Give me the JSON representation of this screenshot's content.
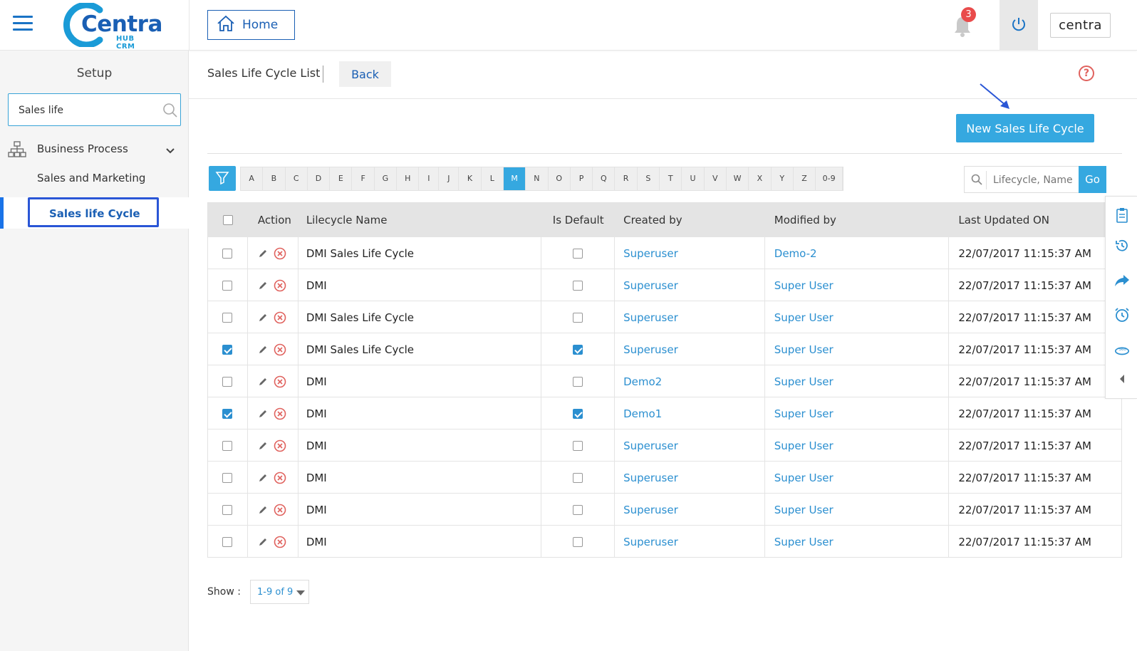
{
  "header": {
    "logo_text": "Centra",
    "logo_sub": "HUB CRM",
    "home_label": "Home",
    "notification_count": "3",
    "brand_label": "centra"
  },
  "sidebar": {
    "title": "Setup",
    "search_value": "Sales life",
    "group_label": "Business Process",
    "items": [
      {
        "label": "Sales and Marketing"
      },
      {
        "label": "Sales life Cycle"
      }
    ]
  },
  "toolbar": {
    "title": "Sales Life Cycle  List",
    "back_label": "Back",
    "help_glyph": "?",
    "new_button_label": "New  Sales Life Cycle"
  },
  "alphabet": [
    "A",
    "B",
    "C",
    "D",
    "E",
    "F",
    "G",
    "H",
    "I",
    "J",
    "K",
    "L",
    "M",
    "N",
    "O",
    "P",
    "Q",
    "R",
    "S",
    "T",
    "U",
    "V",
    "W",
    "X",
    "Y",
    "Z",
    "0-9"
  ],
  "alphabet_active": "M",
  "search": {
    "placeholder": "Lifecycle, Name",
    "go_label": "Go"
  },
  "table": {
    "columns": [
      "Action",
      "Lilecycle Name",
      "Is Default",
      "Created by",
      "Modified by",
      "Last Updated ON"
    ],
    "rows": [
      {
        "selected": false,
        "name": "DMI Sales Life Cycle",
        "is_default": false,
        "created_by": "Superuser",
        "modified_by": "Demo-2",
        "updated": "22/07/2017 11:15:37 AM"
      },
      {
        "selected": false,
        "name": "DMI",
        "is_default": false,
        "created_by": "Superuser",
        "modified_by": "Super User",
        "updated": "22/07/2017 11:15:37 AM"
      },
      {
        "selected": false,
        "name": "DMI Sales Life Cycle",
        "is_default": false,
        "created_by": "Superuser",
        "modified_by": "Super User",
        "updated": "22/07/2017 11:15:37 AM"
      },
      {
        "selected": true,
        "name": "DMI Sales Life Cycle",
        "is_default": true,
        "created_by": "Superuser",
        "modified_by": "Super User",
        "updated": "22/07/2017 11:15:37 AM"
      },
      {
        "selected": false,
        "name": "DMI",
        "is_default": false,
        "created_by": "Demo2",
        "modified_by": "Super User",
        "updated": "22/07/2017 11:15:37 AM"
      },
      {
        "selected": true,
        "name": "DMI",
        "is_default": true,
        "created_by": "Demo1",
        "modified_by": "Super User",
        "updated": "22/07/2017 11:15:37 AM"
      },
      {
        "selected": false,
        "name": "DMI",
        "is_default": false,
        "created_by": "Superuser",
        "modified_by": "Super User",
        "updated": "22/07/2017 11:15:37 AM"
      },
      {
        "selected": false,
        "name": "DMI",
        "is_default": false,
        "created_by": "Superuser",
        "modified_by": "Super User",
        "updated": "22/07/2017 11:15:37 AM"
      },
      {
        "selected": false,
        "name": "DMI",
        "is_default": false,
        "created_by": "Superuser",
        "modified_by": "Super User",
        "updated": "22/07/2017 11:15:37 AM"
      },
      {
        "selected": false,
        "name": "DMI",
        "is_default": false,
        "created_by": "Superuser",
        "modified_by": "Super User",
        "updated": "22/07/2017 11:15:37 AM"
      }
    ]
  },
  "pagination": {
    "show_label": "Show :",
    "value": "1-9 of 9"
  },
  "colors": {
    "accent": "#35a8e0",
    "brand": "#1a5fb4",
    "link": "#2b8fd0",
    "danger": "#e0625e"
  },
  "rail_icons": [
    "clipboard-icon",
    "history-icon",
    "share-icon",
    "alarm-icon",
    "view-360-icon",
    "collapse-left-icon"
  ]
}
